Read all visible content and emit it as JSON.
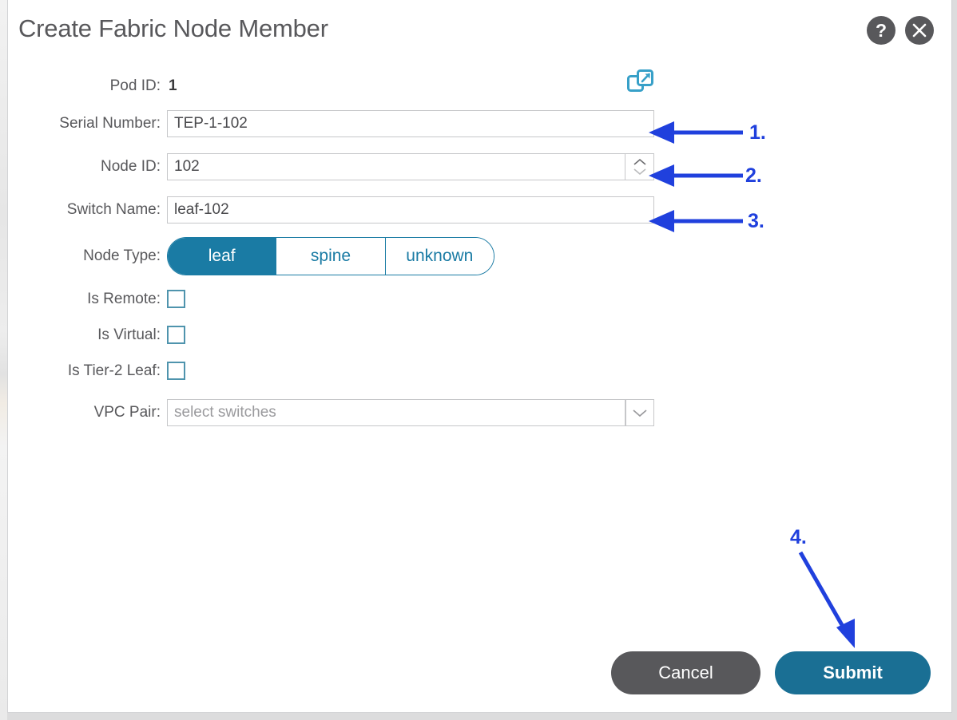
{
  "dialog": {
    "title": "Create Fabric Node Member",
    "help_icon": "help-icon",
    "close_icon": "close-icon"
  },
  "colors": {
    "accent_teal": "#1a7ba4",
    "submit_teal": "#1a6f94",
    "gray_dark": "#58585b",
    "annotation_blue": "#2040dd",
    "checkbox_border": "#4f94ad",
    "field_border": "#c6c7c9"
  },
  "form": {
    "pod_id": {
      "label": "Pod ID:",
      "value": "1",
      "external_link_icon": "external-link-icon"
    },
    "serial_number": {
      "label": "Serial Number:",
      "value": "TEP-1-102"
    },
    "node_id": {
      "label": "Node ID:",
      "value": "102"
    },
    "switch_name": {
      "label": "Switch Name:",
      "value": "leaf-102"
    },
    "node_type": {
      "label": "Node Type:",
      "options": [
        "leaf",
        "spine",
        "unknown"
      ],
      "selected": "leaf"
    },
    "is_remote": {
      "label": "Is Remote:",
      "checked": false
    },
    "is_virtual": {
      "label": "Is Virtual:",
      "checked": false
    },
    "is_tier2_leaf": {
      "label": "Is Tier-2 Leaf:",
      "checked": false
    },
    "vpc_pair": {
      "label": "VPC Pair:",
      "value": "",
      "placeholder": "select switches"
    }
  },
  "footer": {
    "cancel_label": "Cancel",
    "submit_label": "Submit"
  },
  "annotations": [
    {
      "id": "1",
      "label": "1.",
      "target": "serial-number-field"
    },
    {
      "id": "2",
      "label": "2.",
      "target": "node-id-spinner"
    },
    {
      "id": "3",
      "label": "3.",
      "target": "switch-name-field"
    },
    {
      "id": "4",
      "label": "4.",
      "target": "submit-button"
    }
  ]
}
